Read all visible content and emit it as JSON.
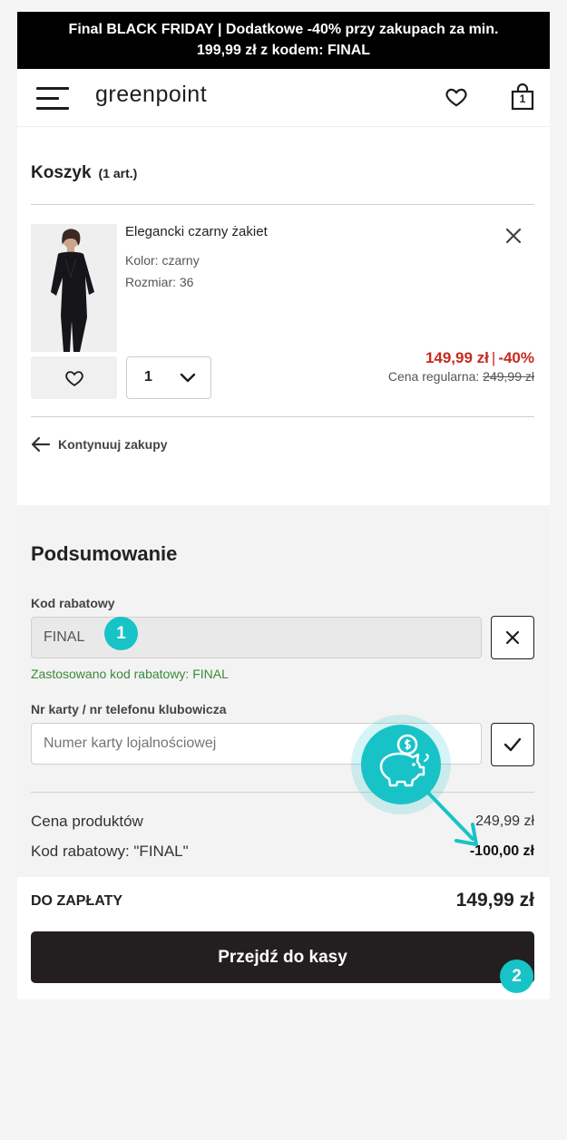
{
  "promo": {
    "line1": "Final BLACK FRIDAY | Dodatkowe -40% przy zakupach za min.",
    "line2": "199,99 zł z kodem: FINAL"
  },
  "header": {
    "logo": "greenpoint",
    "menu_icon": "hamburger-menu-icon",
    "wishlist_icon": "heart-icon",
    "cart_icon": "shopping-bag-icon",
    "cart_count": "1"
  },
  "cart": {
    "title": "Koszyk",
    "count": "(1 art.)",
    "item": {
      "name": "Elegancki czarny żakiet",
      "color": "Kolor: czarny",
      "size": "Rozmiar: 36",
      "price": "149,99 zł",
      "discount": "-40%",
      "regular_label": "Cena regularna:",
      "regular_price": "249,99 zł",
      "quantity": "1"
    },
    "continue_label": "Kontynuuj zakupy"
  },
  "summary": {
    "title": "Podsumowanie",
    "discount_label": "Kod rabatowy",
    "discount_value": "FINAL",
    "discount_applied": "Zastosowano kod rabatowy: FINAL",
    "card_label": "Nr karty / nr telefonu klubowicza",
    "card_placeholder": "Numer karty lojalnościowej",
    "rows": [
      {
        "label": "Cena produktów",
        "value": "249,99 zł"
      },
      {
        "label": "Kod rabatowy: \"FINAL\"",
        "value": "-100,00 zł"
      }
    ],
    "pay_label": "DO ZAPŁATY",
    "pay_total": "149,99 zł",
    "checkout_label": "Przejdź do kasy"
  },
  "annotations": {
    "badge1": "1",
    "badge2": "2",
    "accent": "#18c3c7"
  }
}
